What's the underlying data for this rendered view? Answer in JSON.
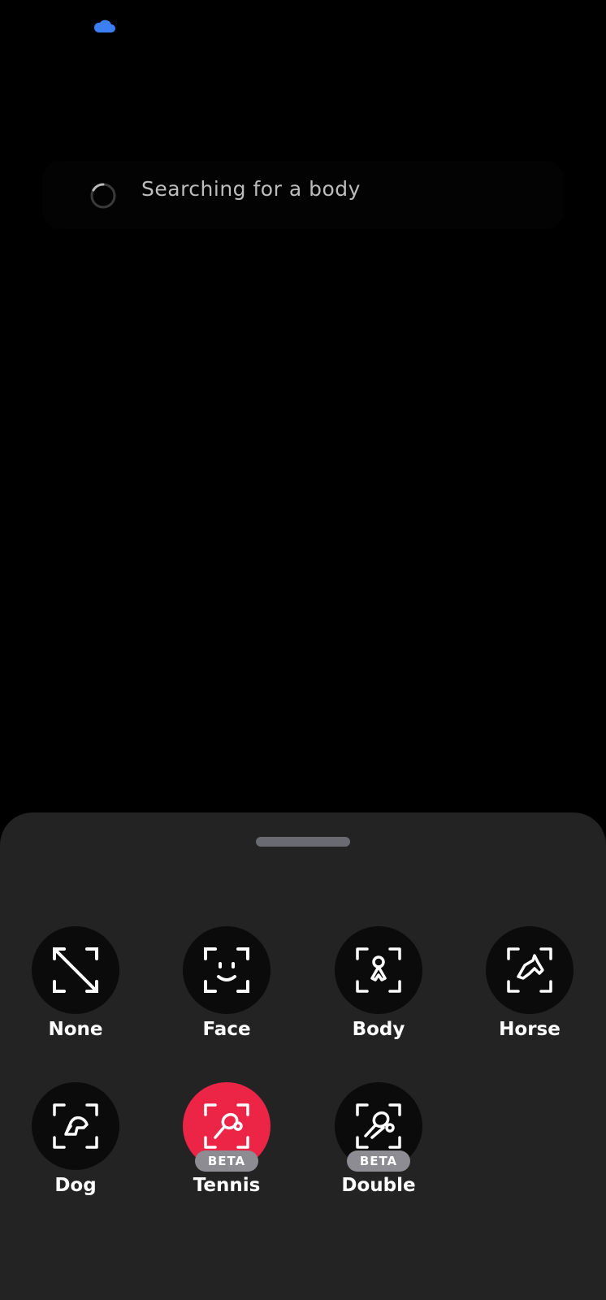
{
  "status": {
    "cloud_icon": "cloud-icon",
    "cloud_color": "#3b7ff2",
    "message": "Searching for a body"
  },
  "sheet": {
    "selected": "Tennis",
    "selected_color": "#ec2547",
    "options": [
      {
        "label": "None",
        "icon": "none-frame-icon"
      },
      {
        "label": "Face",
        "icon": "face-frame-icon"
      },
      {
        "label": "Body",
        "icon": "body-frame-icon"
      },
      {
        "label": "Horse",
        "icon": "horse-frame-icon"
      },
      {
        "label": "Dog",
        "icon": "dog-frame-icon"
      },
      {
        "label": "Tennis",
        "icon": "tennis-racket-frame-icon",
        "badge": "BETA"
      },
      {
        "label": "Double",
        "icon": "double-racket-frame-icon",
        "badge": "BETA"
      }
    ]
  }
}
